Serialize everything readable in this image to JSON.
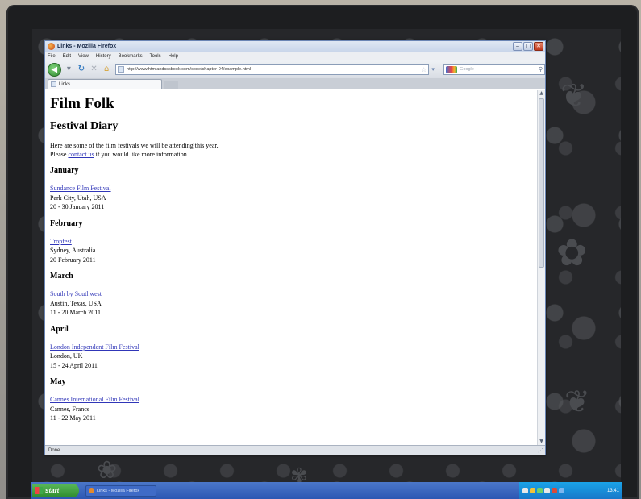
{
  "window": {
    "title": "Links - Mozilla Firefox"
  },
  "menu": [
    "File",
    "Edit",
    "View",
    "History",
    "Bookmarks",
    "Tools",
    "Help"
  ],
  "navigation": {
    "url": "http://www.htmlandcssbook.com/code/chapter-04/example.html",
    "search_placeholder": "Google"
  },
  "tab": {
    "label": "Links"
  },
  "page": {
    "site_title": "Film Folk",
    "heading": "Festival Diary",
    "intro_line1": "Here are some of the film festivals we will be attending this year.",
    "intro_prefix": "Please ",
    "contact_link": "contact us",
    "intro_suffix": " if you would like more information.",
    "months": [
      {
        "name": "January",
        "festival": "Sundance Film Festival",
        "location": "Park City, Utah, USA",
        "dates": "20 - 30 January 2011"
      },
      {
        "name": "February",
        "festival": "Tropfest",
        "location": "Sydney, Australia",
        "dates": "20 February 2011"
      },
      {
        "name": "March",
        "festival": "South by Southwest",
        "location": "Austin, Texas, USA",
        "dates": "11 - 20 March 2011"
      },
      {
        "name": "April",
        "festival": "London Independent Film Festival",
        "location": "London, UK",
        "dates": "15 - 24 April 2011"
      },
      {
        "name": "May",
        "festival": "Cannes International Film Festival",
        "location": "Cannes, France",
        "dates": "11 - 22 May 2011"
      }
    ]
  },
  "status": {
    "text": "Done"
  },
  "taskbar": {
    "start_label": "start",
    "task_label": "Links - Mozilla Firefox",
    "clock": "13:41"
  },
  "colors": {
    "link": "#3036b8",
    "titlebar": "#c9d6ea",
    "taskbar": "#2c57b3"
  }
}
